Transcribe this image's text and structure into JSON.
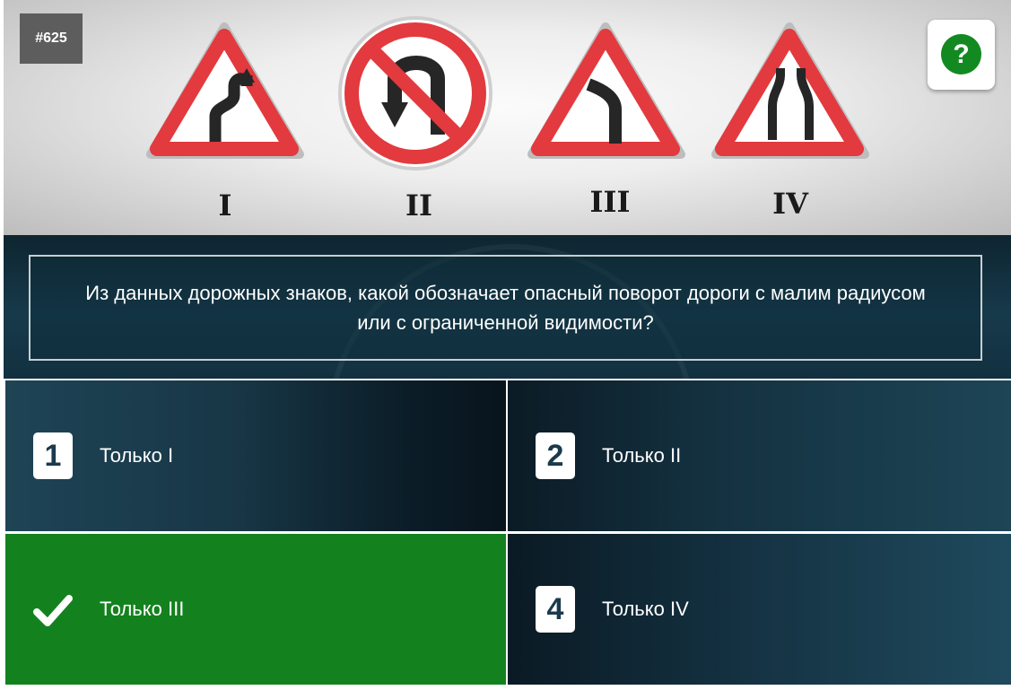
{
  "question_number": "#625",
  "help_button": {
    "icon": "question-circle-icon",
    "label": "?",
    "color": "#138a21"
  },
  "signs": [
    {
      "roman": "I",
      "icon": "double-bend-warning-sign-icon"
    },
    {
      "roman": "II",
      "icon": "no-u-turn-sign-icon"
    },
    {
      "roman": "III",
      "icon": "dangerous-bend-right-sign-icon"
    },
    {
      "roman": "IV",
      "icon": "road-narrows-sign-icon"
    }
  ],
  "question": {
    "text": "Из данных дорожных знаков, какой обозначает опасный поворот дороги с малим радиусом или с ограниченной видимости?"
  },
  "answers": [
    {
      "number": "1",
      "label": "Только I",
      "state": "default"
    },
    {
      "number": "2",
      "label": "Только II",
      "state": "default"
    },
    {
      "number": "3",
      "label": "Только III",
      "state": "correct",
      "icon": "checkmark-icon"
    },
    {
      "number": "4",
      "label": "Только IV",
      "state": "default"
    }
  ],
  "colors": {
    "correct": "#13821e",
    "sign_red": "#e23a3e",
    "panel_dark": "#173a4b"
  }
}
